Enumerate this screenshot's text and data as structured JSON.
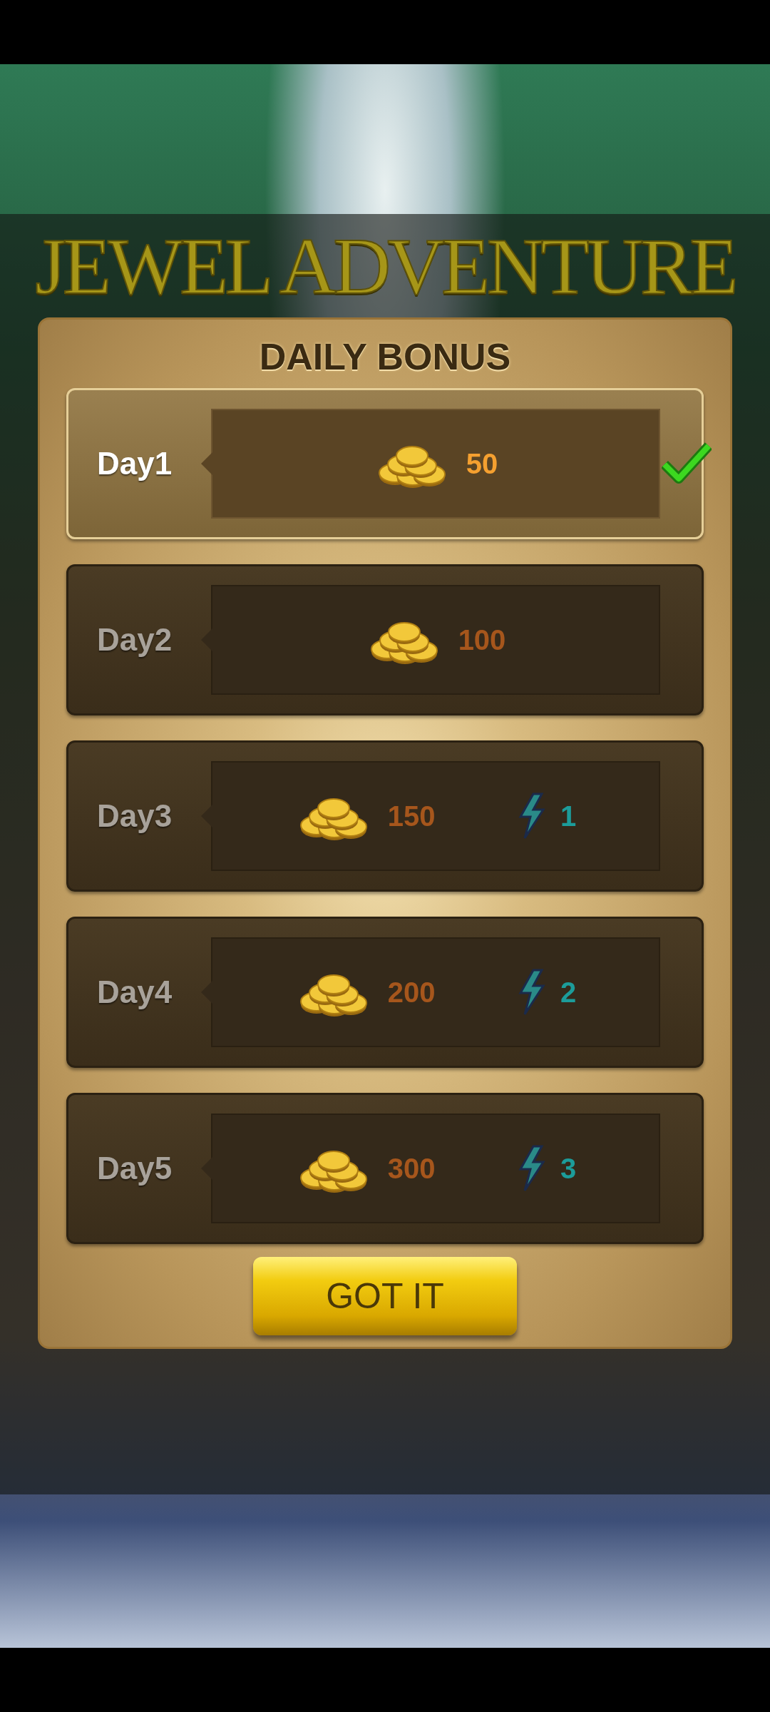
{
  "title": "JEWEL ADVENTURE",
  "dialog": {
    "heading": "DAILY BONUS",
    "days": [
      {
        "label": "Day1",
        "claimed": true,
        "rewards": [
          {
            "kind": "coin",
            "amount": "50"
          }
        ]
      },
      {
        "label": "Day2",
        "claimed": false,
        "rewards": [
          {
            "kind": "coin",
            "amount": "100"
          }
        ]
      },
      {
        "label": "Day3",
        "claimed": false,
        "rewards": [
          {
            "kind": "coin",
            "amount": "150"
          },
          {
            "kind": "energy",
            "amount": "1"
          }
        ]
      },
      {
        "label": "Day4",
        "claimed": false,
        "rewards": [
          {
            "kind": "coin",
            "amount": "200"
          },
          {
            "kind": "energy",
            "amount": "2"
          }
        ]
      },
      {
        "label": "Day5",
        "claimed": false,
        "rewards": [
          {
            "kind": "coin",
            "amount": "300"
          },
          {
            "kind": "energy",
            "amount": "3"
          }
        ]
      }
    ],
    "button": "GOT IT"
  }
}
